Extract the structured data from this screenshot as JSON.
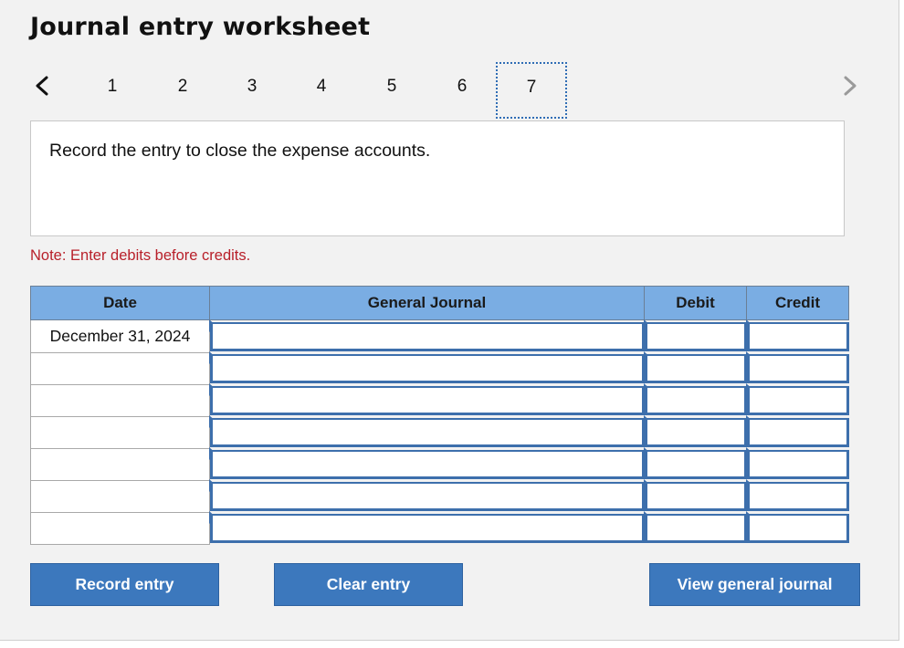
{
  "title": "Journal entry worksheet",
  "nav": {
    "prev_icon": "chevron-left-icon",
    "next_icon": "chevron-right-icon",
    "steps": [
      "1",
      "2",
      "3",
      "4",
      "5",
      "6",
      "7"
    ],
    "active_step": "7"
  },
  "prompt": "Record the entry to close the expense accounts.",
  "note": "Note: Enter debits before credits.",
  "table": {
    "headers": {
      "date": "Date",
      "journal": "General Journal",
      "debit": "Debit",
      "credit": "Credit"
    },
    "rows": [
      {
        "date": "December 31, 2024",
        "account": "",
        "debit": "",
        "credit": ""
      },
      {
        "date": "",
        "account": "",
        "debit": "",
        "credit": ""
      },
      {
        "date": "",
        "account": "",
        "debit": "",
        "credit": ""
      },
      {
        "date": "",
        "account": "",
        "debit": "",
        "credit": ""
      },
      {
        "date": "",
        "account": "",
        "debit": "",
        "credit": ""
      },
      {
        "date": "",
        "account": "",
        "debit": "",
        "credit": ""
      },
      {
        "date": "",
        "account": "",
        "debit": "",
        "credit": ""
      }
    ]
  },
  "buttons": {
    "record": "Record entry",
    "clear": "Clear entry",
    "view": "View general journal"
  },
  "colors": {
    "header_bg": "#7aade3",
    "button_bg": "#3c78bd",
    "input_border": "#3d6fac",
    "note_text": "#b8202a"
  }
}
